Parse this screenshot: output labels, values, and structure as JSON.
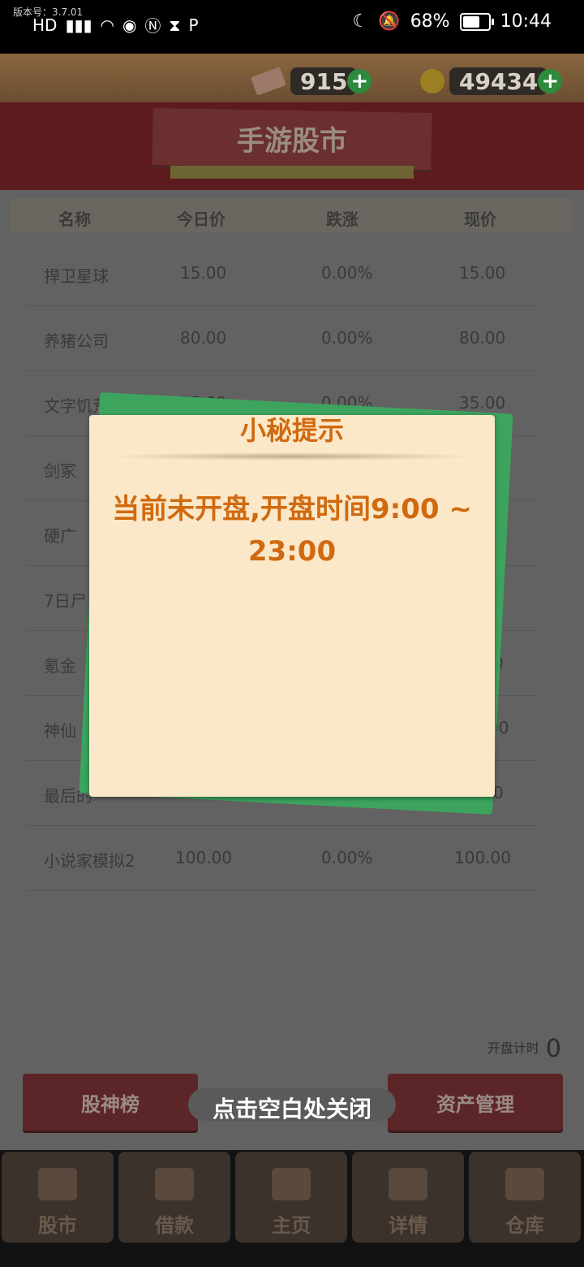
{
  "status": {
    "version": "版本号：3.7.01",
    "battery": "68%",
    "time": "10:44",
    "battery_level": 0.68
  },
  "resources": {
    "cash": "915",
    "coins": "49434"
  },
  "header": {
    "title": "手游股市"
  },
  "table": {
    "columns": [
      "名称",
      "今日价",
      "跌涨",
      "现价"
    ],
    "rows": [
      [
        "捍卫星球",
        "15.00",
        "0.00%",
        "15.00"
      ],
      [
        "养猪公司",
        "80.00",
        "0.00%",
        "80.00"
      ],
      [
        "文字饥荒",
        "35.00",
        "0.00%",
        "35.00"
      ],
      [
        "剑冢",
        "",
        "",
        ""
      ],
      [
        "硬广",
        "",
        "",
        "0"
      ],
      [
        "7日尸",
        "",
        "",
        "0"
      ],
      [
        "氪金",
        "",
        "",
        "0"
      ],
      [
        "神仙",
        "",
        "",
        "00"
      ],
      [
        "最后的",
        "",
        "",
        "0"
      ],
      [
        "小说家模拟2",
        "100.00",
        "0.00%",
        "100.00"
      ]
    ]
  },
  "countdown": {
    "label": "开盘计时",
    "value": "0"
  },
  "buttons": {
    "ranking": "股神榜",
    "asset": "资产管理",
    "close_hint": "点击空白处关闭"
  },
  "nav": {
    "items": [
      "股市",
      "借款",
      "主页",
      "详情",
      "仓库"
    ]
  },
  "modal": {
    "title": "小秘提示",
    "message": "当前未开盘,开盘时间9:00 ~ 23:00"
  }
}
